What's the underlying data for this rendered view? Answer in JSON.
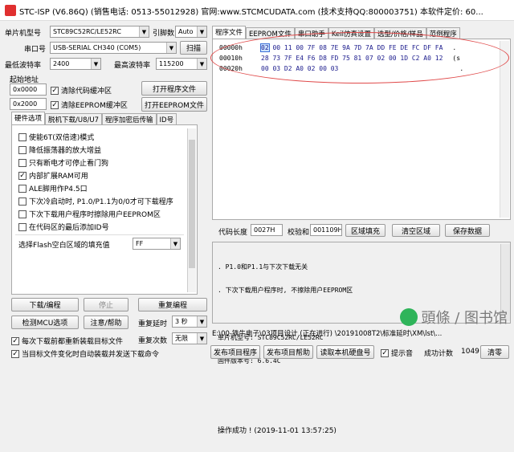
{
  "window": {
    "title": "STC-ISP (V6.86Q) (销售电话: 0513-55012928) 官网:www.STCMCUDATA.com (技术支持QQ:800003751) 本软件定价: 60..."
  },
  "left": {
    "mcu_label": "单片机型号",
    "mcu_value": "STC89C52RC/LE52RC",
    "pin_label": "引脚数",
    "pin_value": "Auto",
    "port_label": "串口号",
    "port_value": "USB-SERIAL CH340 (COM5)",
    "scan_btn": "扫描",
    "min_baud_label": "最低波特率",
    "min_baud_value": "2400",
    "max_baud_label": "最高波特率",
    "max_baud_value": "115200",
    "start_addr_label": "起始地址",
    "addr1": "0x0000",
    "clear_code_chk": "清除代码缓冲区",
    "open_prog_btn": "打开程序文件",
    "addr2": "0x2000",
    "clear_eeprom_chk": "清除EEPROM缓冲区",
    "open_eeprom_btn": "打开EEPROM文件",
    "tabs": [
      "硬件选项",
      "脱机下载/U8/U7",
      "程序加密后传输",
      "ID号"
    ],
    "options": [
      {
        "label": "使能6T(双倍速)模式",
        "checked": false
      },
      {
        "label": "降低振荡器的放大增益",
        "checked": false
      },
      {
        "label": "只有断电才可停止看门狗",
        "checked": false
      },
      {
        "label": "内部扩展RAM可用",
        "checked": true
      },
      {
        "label": "ALE脚用作P4.5口",
        "checked": false
      },
      {
        "label": "下次冷启动时, P1.0/P1.1为0/0才可下载程序",
        "checked": false
      },
      {
        "label": "下次下载用户程序时擦除用户EEPROM区",
        "checked": false
      },
      {
        "label": "在代码区的最后添加ID号",
        "checked": false
      }
    ],
    "fill_label": "选择Flash空白区域的填充值",
    "fill_value": "FF",
    "download_btn": "下载/编程",
    "stop_btn": "停止",
    "reprogram_btn": "重复编程",
    "detect_btn": "检测MCU选项",
    "help_btn": "注意/帮助",
    "repeat_delay_label": "重复延时",
    "repeat_delay_value": "3 秒",
    "repeat_count_label": "重复次数",
    "repeat_count_value": "无限",
    "reload_chk": "每次下载前都重新装载目标文件",
    "auto_send_chk": "当目标文件变化时自动装载并发送下载命令"
  },
  "right": {
    "tabs": [
      "程序文件",
      "EEPROM文件",
      "串口助手",
      "Keil仿真设置",
      "选型/价格/样品",
      "范例程序"
    ],
    "hex_rows": [
      {
        "addr": "00000h",
        "bytes": "02 00 11 00 7F 08 7E 9A 7D 7A DD FE DE FC DF FA",
        "first": "02",
        "rest": " 00 11 00 7F 08 7E 9A 7D 7A DD FE DE FC DF FA",
        "ascii": "."
      },
      {
        "addr": "00010h",
        "bytes": "28 73 7F E4 F6 D8 FD 75 81 07 02 00 1D C2 A0 12",
        "first": "28",
        "rest": " 73 7F E4 F6 D8 FD 75 81 07 02 00 1D C2 A0 12",
        "ascii": "(s"
      },
      {
        "addr": "00020h",
        "bytes": "00 03 D2 A0 02 00 03",
        "first": "00",
        "rest": " 03 D2 A0 02 00 03",
        "ascii": "."
      }
    ],
    "code_len_label": "代码长度",
    "code_len_value": "0027H",
    "checksum_label": "校验和",
    "checksum_value": "001109H",
    "fill_area_btn": "区域填充",
    "clear_area_btn": "清空区域",
    "save_data_btn": "保存数据",
    "log_lines": [
      ". P1.0和P1.1与下次下载无关",
      ". 下次下载用户程序时, 不擦除用户EEPROM区",
      "",
      "单片机型号: STC89C52RC/LE52RC",
      "固件版本号: 6.6.4C",
      "",
      "",
      "操作成功 ! (2019-11-01 13:57:25)"
    ],
    "path": "E:\\00-铁牛电子\\03项目设计 (正在进行) \\20191008T2\\标准延时\\XM\\lst\\...",
    "publish_btn": "发布项目程序",
    "publish_help_btn": "发布项目帮助",
    "read_id_btn": "读取本机硬盘号",
    "sound_chk": "提示音",
    "success_label": "成功计数",
    "success_value": "1049",
    "clear_btn": "清零"
  },
  "watermark": "頭條 / 图书馆"
}
